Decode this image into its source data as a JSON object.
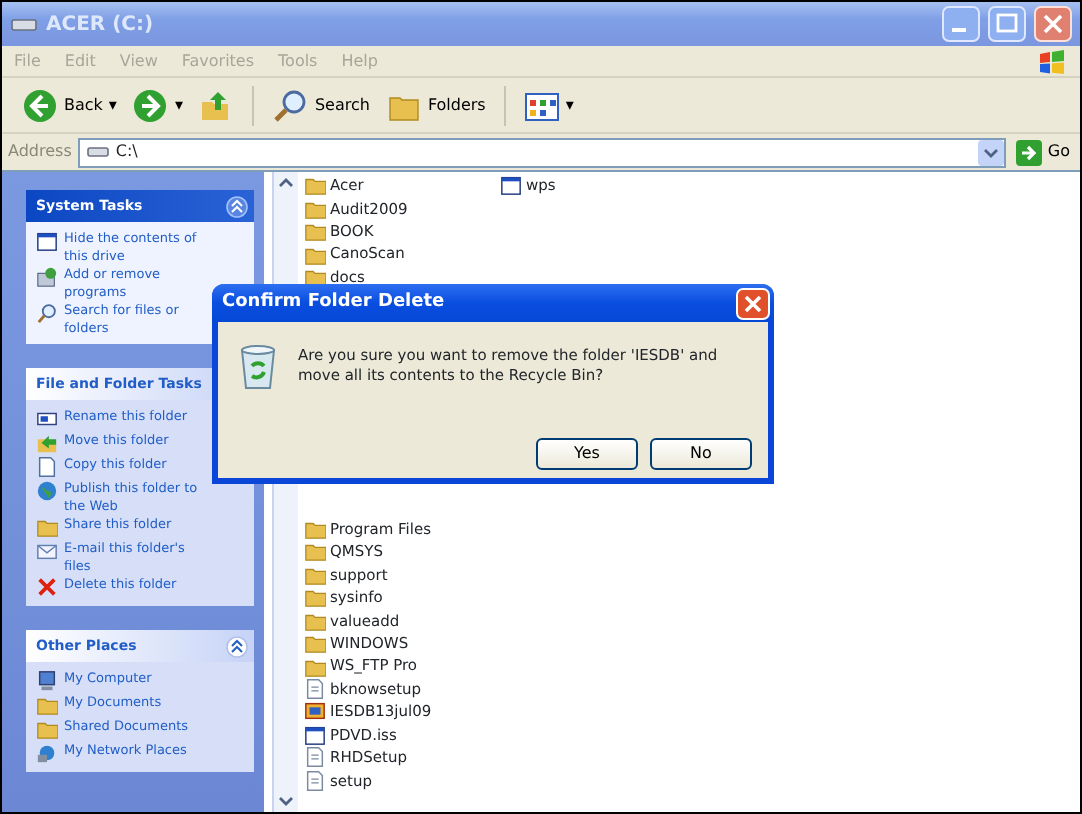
{
  "window": {
    "title": "ACER (C:)"
  },
  "menu": [
    {
      "label": "File",
      "disabled": true
    },
    {
      "label": "Edit",
      "disabled": true
    },
    {
      "label": "View",
      "disabled": true
    },
    {
      "label": "Favorites",
      "disabled": true
    },
    {
      "label": "Tools",
      "disabled": true
    },
    {
      "label": "Help",
      "disabled": true
    }
  ],
  "toolbar": [
    {
      "kind": "back",
      "label": "Back",
      "dropdown": "▾"
    },
    {
      "kind": "forward",
      "dropdown": "▾"
    },
    {
      "kind": "up"
    },
    {
      "kind": "search",
      "label": "Search"
    },
    {
      "kind": "folders",
      "label": "Folders"
    },
    {
      "kind": "views",
      "dropdown": "▾"
    }
  ],
  "address": {
    "label": "Address",
    "value": "C:\\",
    "go": "Go"
  },
  "sidebar": [
    {
      "title": "System Tasks",
      "kind": "special",
      "collapse_button": true,
      "items": [
        {
          "kind": "window",
          "label": "Hide the contents of this drive"
        },
        {
          "kind": "install",
          "label": "Add or remove programs"
        },
        {
          "kind": "search",
          "label": "Search for files or folders"
        }
      ]
    },
    {
      "title": "File and Folder Tasks",
      "kind": "normal",
      "items": [
        {
          "kind": "rename",
          "label": "Rename this folder"
        },
        {
          "kind": "move",
          "label": "Move this folder"
        },
        {
          "kind": "page",
          "label": "Copy this folder"
        },
        {
          "kind": "globe",
          "label": "Publish this folder to the Web"
        },
        {
          "kind": "folder",
          "label": "Share this folder"
        },
        {
          "kind": "mail",
          "label": "E-mail this folder's files"
        },
        {
          "kind": "delete",
          "label": "Delete this folder"
        }
      ]
    },
    {
      "title": "Other Places",
      "kind": "normal",
      "collapse_button": true,
      "items": [
        {
          "kind": "computer",
          "label": "My Computer"
        },
        {
          "kind": "folder",
          "label": "My Documents"
        },
        {
          "kind": "folder",
          "label": "Shared Documents"
        },
        {
          "kind": "network",
          "label": "My Network Places"
        }
      ]
    }
  ],
  "files": {
    "column_1_top": [
      {
        "name": "Acer",
        "kind": "folder"
      },
      {
        "name": "Audit2009",
        "kind": "folder"
      },
      {
        "name": "BOOK",
        "kind": "folder"
      },
      {
        "name": "CanoScan",
        "kind": "folder"
      },
      {
        "name": "docs",
        "kind": "folder"
      }
    ],
    "column_1_bottom": [
      {
        "name": "Program Files",
        "kind": "folder"
      },
      {
        "name": "QMSYS",
        "kind": "folder"
      },
      {
        "name": "support",
        "kind": "folder"
      },
      {
        "name": "sysinfo",
        "kind": "folder"
      },
      {
        "name": "valueadd",
        "kind": "folder"
      },
      {
        "name": "WINDOWS",
        "kind": "folder"
      },
      {
        "name": "WS_FTP Pro",
        "kind": "folder"
      },
      {
        "name": "bknowsetup",
        "kind": "file"
      },
      {
        "name": "IESDB13jul09",
        "kind": "app"
      },
      {
        "name": "PDVD.iss",
        "kind": "window"
      },
      {
        "name": "RHDSetup",
        "kind": "file"
      },
      {
        "name": "setup",
        "kind": "file"
      }
    ],
    "column_2": [
      {
        "name": "wps",
        "kind": "window"
      }
    ]
  },
  "dialog": {
    "title": "Confirm Folder Delete",
    "message": "Are you sure you want to remove the folder 'IESDB' and move all its contents to the Recycle Bin?",
    "buttons": [
      "Yes",
      "No"
    ]
  }
}
